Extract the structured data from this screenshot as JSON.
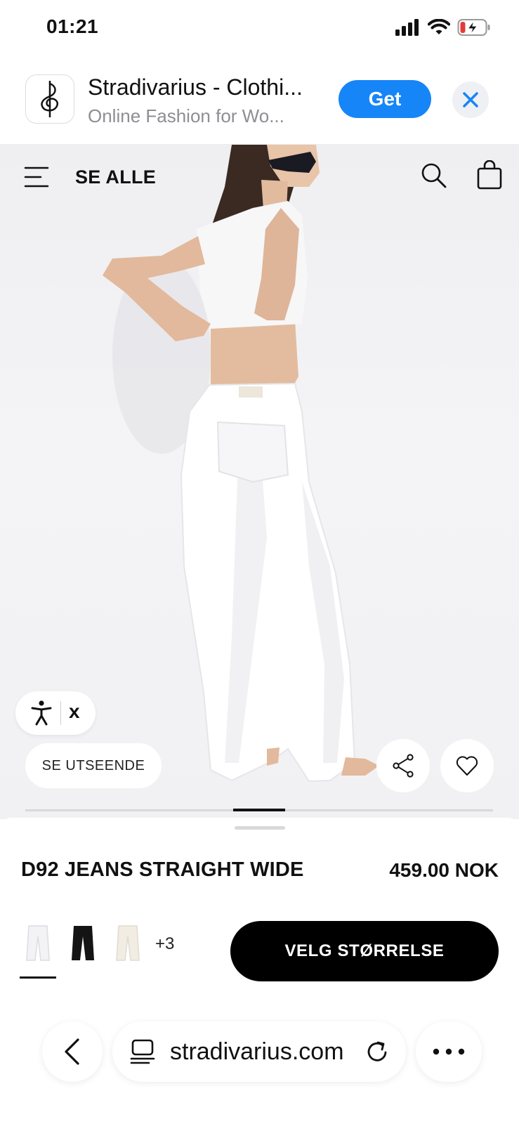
{
  "status_bar": {
    "time": "01:21",
    "icons": [
      "signal-icon",
      "wifi-icon",
      "battery-charging-icon"
    ]
  },
  "app_banner": {
    "title": "Stradivarius - Clothi...",
    "subtitle": "Online Fashion for Wo...",
    "get_label": "Get",
    "accent_color": "#1685f8"
  },
  "header": {
    "menu_label": "SE ALLE"
  },
  "hero": {
    "accessibility_close": "x",
    "look_button_label": "SE UTSEENDE",
    "gallery_progress": 0.11
  },
  "product": {
    "name": "D92 JEANS STRAIGHT WIDE",
    "price": "459.00 NOK",
    "swatches": [
      {
        "color": "white",
        "selected": true
      },
      {
        "color": "black",
        "selected": false
      },
      {
        "color": "ecru",
        "selected": false
      }
    ],
    "more_colors": "+3",
    "size_button_label": "VELG STØRRELSE"
  },
  "browser": {
    "url": "stradivarius.com"
  }
}
